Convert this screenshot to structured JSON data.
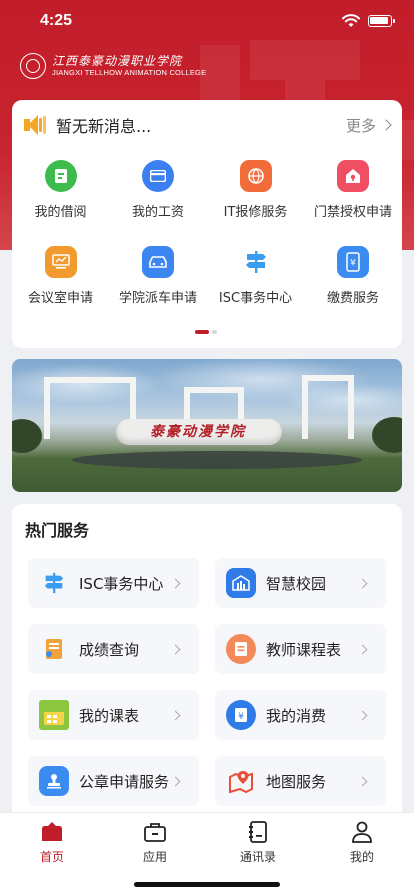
{
  "status_bar": {
    "time": "4:25"
  },
  "header": {
    "logo_cn": "江西泰豪动漫职业学院",
    "logo_en": "JIANGXI TELLHOW ANIMATION COLLEGE"
  },
  "notice": {
    "message": "暂无新消息...",
    "more_label": "更多"
  },
  "quick_grid": [
    {
      "label": "我的借阅",
      "icon": "book-icon",
      "color": "#3dbb4e"
    },
    {
      "label": "我的工资",
      "icon": "wallet-card-icon",
      "color": "#3c7ff0"
    },
    {
      "label": "IT报修服务",
      "icon": "repair-globe-icon",
      "color": "#f26b3a"
    },
    {
      "label": "门禁授权申请",
      "icon": "door-access-icon",
      "color": "#ef4e63"
    },
    {
      "label": "会议室申请",
      "icon": "meeting-room-icon",
      "color": "#f39a2e"
    },
    {
      "label": "学院派车申请",
      "icon": "car-icon",
      "color": "#3c86f2"
    },
    {
      "label": "ISC事务中心",
      "icon": "signpost-icon",
      "color": "#3a9df0"
    },
    {
      "label": "缴费服务",
      "icon": "payment-phone-icon",
      "color": "#3a8cf0"
    }
  ],
  "banner": {
    "sign_text": "泰豪动漫学院"
  },
  "hot_services": {
    "title": "热门服务",
    "items": [
      {
        "label": "ISC事务中心",
        "icon": "signpost-icon",
        "color": "#3a9df0"
      },
      {
        "label": "智慧校园",
        "icon": "campus-building-icon",
        "color": "#2f7be8"
      },
      {
        "label": "成绩查询",
        "icon": "grades-report-icon",
        "color": "#f2a23a"
      },
      {
        "label": "教师课程表",
        "icon": "schedule-doc-icon",
        "color": "#f28a5a"
      },
      {
        "label": "我的课表",
        "icon": "calendar-icon",
        "color": "#8cc63f"
      },
      {
        "label": "我的消费",
        "icon": "consumption-doc-icon",
        "color": "#2f7be8"
      },
      {
        "label": "公章申请服务",
        "icon": "stamp-icon",
        "color": "#3a8cf0"
      },
      {
        "label": "地图服务",
        "icon": "map-pin-icon",
        "color": "#e8503a"
      }
    ]
  },
  "tabbar": [
    {
      "label": "首页",
      "icon": "home-icon",
      "active": true
    },
    {
      "label": "应用",
      "icon": "briefcase-icon",
      "active": false
    },
    {
      "label": "通讯录",
      "icon": "contacts-book-icon",
      "active": false
    },
    {
      "label": "我的",
      "icon": "user-icon",
      "active": false
    }
  ],
  "colors": {
    "brand_red": "#c21d2a",
    "accent_yellow": "#f5a623"
  }
}
